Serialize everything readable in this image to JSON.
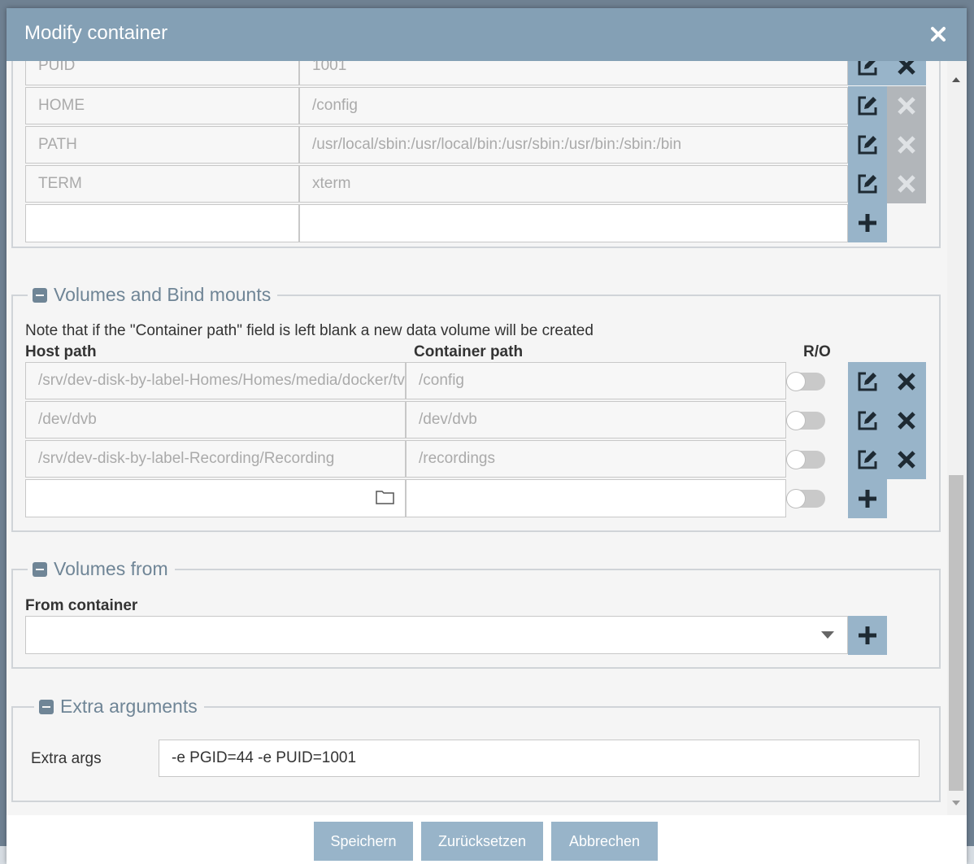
{
  "modal": {
    "title": "Modify container"
  },
  "env_rows": [
    {
      "name": "PUID",
      "value": "1001"
    },
    {
      "name": "HOME",
      "value": "/config"
    },
    {
      "name": "PATH",
      "value": "/usr/local/sbin:/usr/local/bin:/usr/sbin:/usr/bin:/sbin:/bin"
    },
    {
      "name": "TERM",
      "value": "xterm"
    }
  ],
  "volumes": {
    "legend": "Volumes and Bind mounts",
    "note": "Note that if the \"Container path\" field is left blank a new data volume will be created",
    "host_header": "Host path",
    "container_header": "Container path",
    "ro_header": "R/O",
    "rows": [
      {
        "host": "/srv/dev-disk-by-label-Homes/Homes/media/docker/tvheadend",
        "container": "/config"
      },
      {
        "host": "/dev/dvb",
        "container": "/dev/dvb"
      },
      {
        "host": "/srv/dev-disk-by-label-Recording/Recording",
        "container": "/recordings"
      }
    ]
  },
  "volumes_from": {
    "legend": "Volumes from",
    "label": "From container"
  },
  "extra": {
    "legend": "Extra arguments",
    "label": "Extra args",
    "value": "-e PGID=44 -e PUID=1001"
  },
  "footer": {
    "save": "Speichern",
    "reset": "Zurücksetzen",
    "cancel": "Abbrechen"
  },
  "colors": {
    "header": "#84a0b5",
    "button": "#98b4c9",
    "accent_text": "#6f8596"
  }
}
